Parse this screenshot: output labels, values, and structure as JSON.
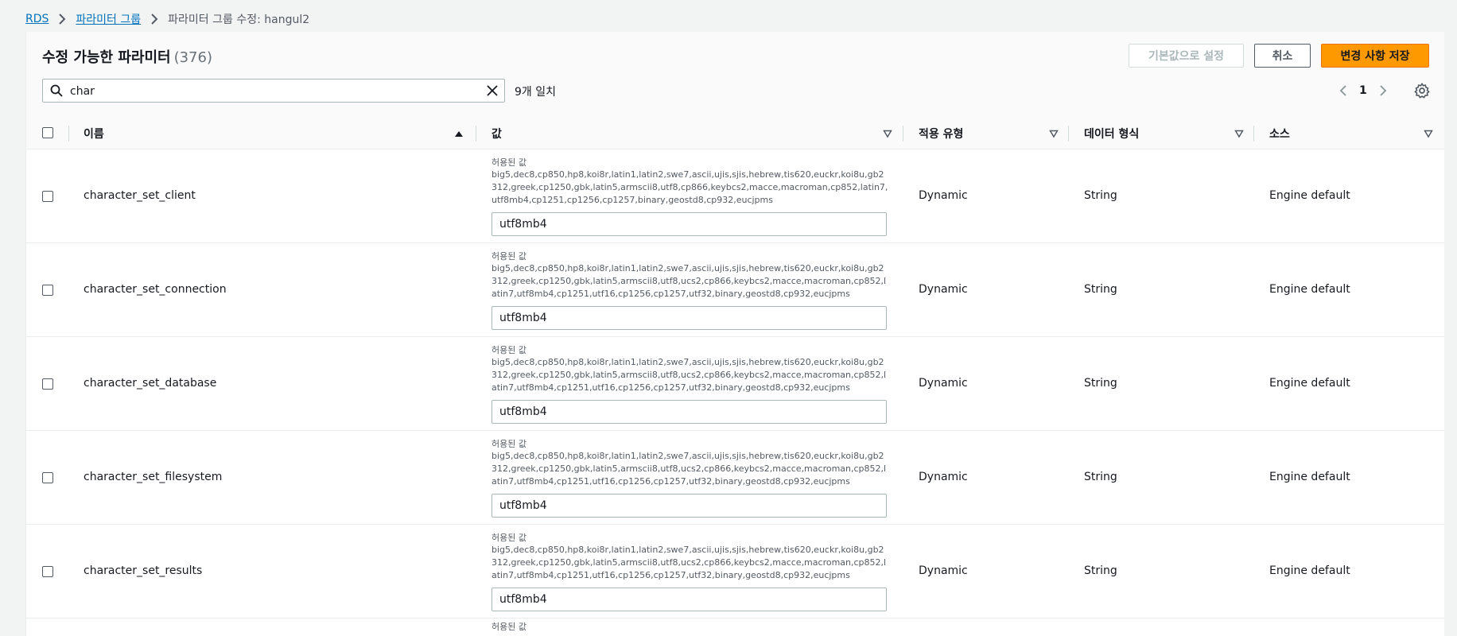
{
  "breadcrumb": {
    "items": [
      "RDS",
      "파라미터 그룹"
    ],
    "current": "파라미터 그룹 수정: hangul2"
  },
  "header": {
    "title": "수정 가능한 파라미터",
    "count": "(376)",
    "buttons": {
      "reset_default": "기본값으로 설정",
      "cancel": "취소",
      "save": "변경 사항 저장"
    }
  },
  "search": {
    "value": "char",
    "match_count": "9개 일치"
  },
  "pagination": {
    "page": "1"
  },
  "table": {
    "columns": {
      "name": "이름",
      "value": "값",
      "apply_type": "적용 유형",
      "data_type": "데이터 형식",
      "source": "소스"
    },
    "allowed_label": "허용된 값",
    "rows": [
      {
        "name": "character_set_client",
        "allowed": "big5,dec8,cp850,hp8,koi8r,latin1,latin2,swe7,ascii,ujis,sjis,hebrew,tis620,euckr,koi8u,gb2312,greek,cp1250,gbk,latin5,armscii8,utf8,cp866,keybcs2,macce,macroman,cp852,latin7,utf8mb4,cp1251,cp1256,cp1257,binary,geostd8,cp932,eucjpms",
        "value": "utf8mb4",
        "apply_type": "Dynamic",
        "data_type": "String",
        "source": "Engine default"
      },
      {
        "name": "character_set_connection",
        "allowed": "big5,dec8,cp850,hp8,koi8r,latin1,latin2,swe7,ascii,ujis,sjis,hebrew,tis620,euckr,koi8u,gb2312,greek,cp1250,gbk,latin5,armscii8,utf8,ucs2,cp866,keybcs2,macce,macroman,cp852,latin7,utf8mb4,cp1251,utf16,cp1256,cp1257,utf32,binary,geostd8,cp932,eucjpms",
        "value": "utf8mb4",
        "apply_type": "Dynamic",
        "data_type": "String",
        "source": "Engine default"
      },
      {
        "name": "character_set_database",
        "allowed": "big5,dec8,cp850,hp8,koi8r,latin1,latin2,swe7,ascii,ujis,sjis,hebrew,tis620,euckr,koi8u,gb2312,greek,cp1250,gbk,latin5,armscii8,utf8,ucs2,cp866,keybcs2,macce,macroman,cp852,latin7,utf8mb4,cp1251,utf16,cp1256,cp1257,utf32,binary,geostd8,cp932,eucjpms",
        "value": "utf8mb4",
        "apply_type": "Dynamic",
        "data_type": "String",
        "source": "Engine default"
      },
      {
        "name": "character_set_filesystem",
        "allowed": "big5,dec8,cp850,hp8,koi8r,latin1,latin2,swe7,ascii,ujis,sjis,hebrew,tis620,euckr,koi8u,gb2312,greek,cp1250,gbk,latin5,armscii8,utf8,ucs2,cp866,keybcs2,macce,macroman,cp852,latin7,utf8mb4,cp1251,utf16,cp1256,cp1257,utf32,binary,geostd8,cp932,eucjpms",
        "value": "utf8mb4",
        "apply_type": "Dynamic",
        "data_type": "String",
        "source": "Engine default"
      },
      {
        "name": "character_set_results",
        "allowed": "big5,dec8,cp850,hp8,koi8r,latin1,latin2,swe7,ascii,ujis,sjis,hebrew,tis620,euckr,koi8u,gb2312,greek,cp1250,gbk,latin5,armscii8,utf8,ucs2,cp866,keybcs2,macce,macroman,cp852,latin7,utf8mb4,cp1251,utf16,cp1256,cp1257,utf32,binary,geostd8,cp932,eucjpms",
        "value": "utf8mb4",
        "apply_type": "Dynamic",
        "data_type": "String",
        "source": "Engine default"
      }
    ],
    "partial_row_label": "허용된 값"
  },
  "colors": {
    "link": "#0073bb",
    "primary": "#ff9900",
    "border": "#aab7b8",
    "text_secondary": "#545b64"
  },
  "icons": {
    "breadcrumb_separator": "chevron-right-icon",
    "search": "search-icon",
    "clear": "close-icon",
    "pager_prev": "chevron-left-icon",
    "pager_next": "chevron-right-icon",
    "preferences": "gear-icon",
    "sort_asc": "caret-up-icon",
    "sort_none": "caret-down-outline-icon"
  }
}
